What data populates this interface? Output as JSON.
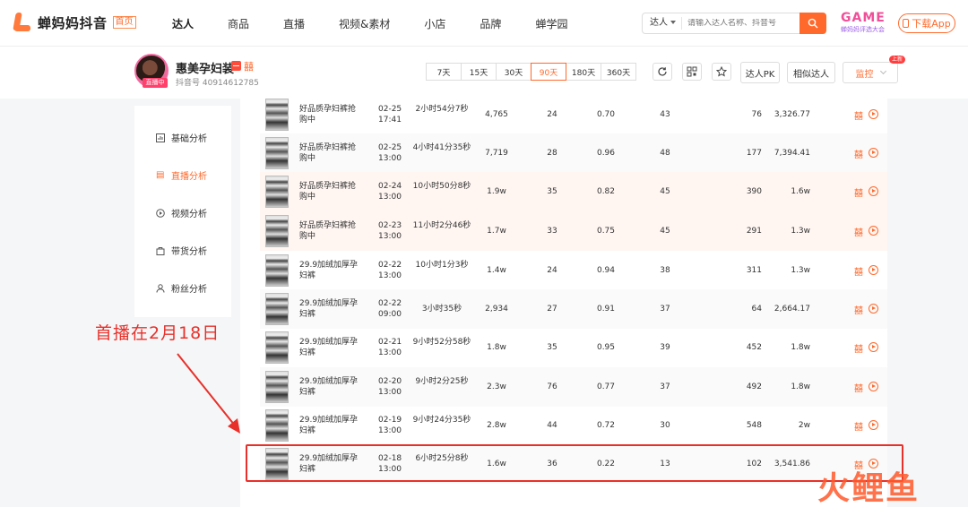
{
  "header": {
    "logo_text": "蝉妈妈抖音",
    "logo_tag": "首页",
    "nav": [
      "达人",
      "商品",
      "直播",
      "视频&素材",
      "小店",
      "品牌",
      "蝉学园"
    ],
    "search_type": "达人",
    "search_placeholder": "请输入达人名称、抖音号",
    "game_logo_big": "GAME",
    "game_logo_small": "蝉妈妈评选大会",
    "download_label": "下载App"
  },
  "profile": {
    "name": "惠美孕妇装",
    "live_badge": "直播中",
    "id_text": "抖音号 40914612785",
    "ranges": [
      "7天",
      "15天",
      "30天",
      "90天",
      "180天",
      "360天"
    ],
    "active_range": "90天",
    "pk_label": "达人PK",
    "similar_label": "相似达人",
    "monitor_label": "监控",
    "new_badge": "上新",
    "brand_icon": "囍"
  },
  "sidebar": {
    "items": [
      {
        "label": "基础分析",
        "icon": "chart-icon"
      },
      {
        "label": "直播分析",
        "icon": "live-icon"
      },
      {
        "label": "视频分析",
        "icon": "play-icon"
      },
      {
        "label": "带货分析",
        "icon": "bag-icon"
      },
      {
        "label": "粉丝分析",
        "icon": "user-icon"
      }
    ],
    "active": "直播分析"
  },
  "table": {
    "rows": [
      {
        "title": "好品质孕妇裤抢购中",
        "date": "02-25",
        "time": "17:41",
        "duration": "2小时54分7秒",
        "v1": "4,765",
        "v2": "24",
        "v3": "0.70",
        "v4": "43",
        "v5": "76",
        "v6": "3,326.77"
      },
      {
        "title": "好品质孕妇裤抢购中",
        "date": "02-25",
        "time": "13:00",
        "duration": "4小时41分35秒",
        "v1": "7,719",
        "v2": "28",
        "v3": "0.96",
        "v4": "48",
        "v5": "177",
        "v6": "7,394.41"
      },
      {
        "title": "好品质孕妇裤抢购中",
        "date": "02-24",
        "time": "13:00",
        "duration": "10小时50分8秒",
        "v1": "1.9w",
        "v2": "35",
        "v3": "0.82",
        "v4": "45",
        "v5": "390",
        "v6": "1.6w"
      },
      {
        "title": "好品质孕妇裤抢购中",
        "date": "02-23",
        "time": "13:00",
        "duration": "11小时2分46秒",
        "v1": "1.7w",
        "v2": "33",
        "v3": "0.75",
        "v4": "45",
        "v5": "291",
        "v6": "1.3w"
      },
      {
        "title": "29.9加绒加厚孕妇裤",
        "date": "02-22",
        "time": "13:00",
        "duration": "10小时1分3秒",
        "v1": "1.4w",
        "v2": "24",
        "v3": "0.94",
        "v4": "38",
        "v5": "311",
        "v6": "1.3w"
      },
      {
        "title": "29.9加绒加厚孕妇裤",
        "date": "02-22",
        "time": "09:00",
        "duration": "3小时35秒",
        "v1": "2,934",
        "v2": "27",
        "v3": "0.91",
        "v4": "37",
        "v5": "64",
        "v6": "2,664.17"
      },
      {
        "title": "29.9加绒加厚孕妇裤",
        "date": "02-21",
        "time": "13:00",
        "duration": "9小时52分58秒",
        "v1": "1.8w",
        "v2": "35",
        "v3": "0.95",
        "v4": "39",
        "v5": "452",
        "v6": "1.8w"
      },
      {
        "title": "29.9加绒加厚孕妇裤",
        "date": "02-20",
        "time": "13:00",
        "duration": "9小时2分25秒",
        "v1": "2.3w",
        "v2": "76",
        "v3": "0.77",
        "v4": "37",
        "v5": "492",
        "v6": "1.8w"
      },
      {
        "title": "29.9加绒加厚孕妇裤",
        "date": "02-19",
        "time": "13:00",
        "duration": "9小时24分35秒",
        "v1": "2.8w",
        "v2": "44",
        "v3": "0.72",
        "v4": "30",
        "v5": "548",
        "v6": "2w"
      },
      {
        "title": "29.9加绒加厚孕妇裤",
        "date": "02-18",
        "time": "13:00",
        "duration": "6小时25分8秒",
        "v1": "1.6w",
        "v2": "36",
        "v3": "0.22",
        "v4": "13",
        "v5": "102",
        "v6": "3,541.86"
      }
    ]
  },
  "annotation": {
    "text": "首播在2月18日",
    "color": "#e8302a"
  },
  "watermark": "火鲤鱼",
  "colors": {
    "accent": "#ff6a2c",
    "annotation": "#e8302a"
  }
}
